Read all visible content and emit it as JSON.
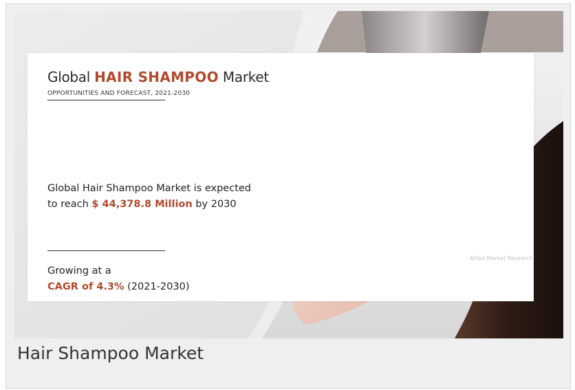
{
  "infographic": {
    "title_prefix": "Global ",
    "title_highlight": "HAIR SHAMPOO",
    "title_suffix": " Market",
    "subtitle": "OPPORTUNITIES AND FORECAST, 2021-2030",
    "stat1_text": "Global Hair Shampoo Market is expected to reach ",
    "stat1_value": "$ 44,378.8 Million",
    "stat1_suffix": " by 2030",
    "stat2_text": "Growing at a ",
    "stat2_value": "CAGR of 4.3%",
    "stat2_suffix": " (2021-2030)",
    "watermark": "Allied Market Research"
  },
  "caption": "Hair Shampoo Market",
  "colors": {
    "accent": "#b04a2e",
    "card_background": "#efefef",
    "text": "#333333"
  }
}
